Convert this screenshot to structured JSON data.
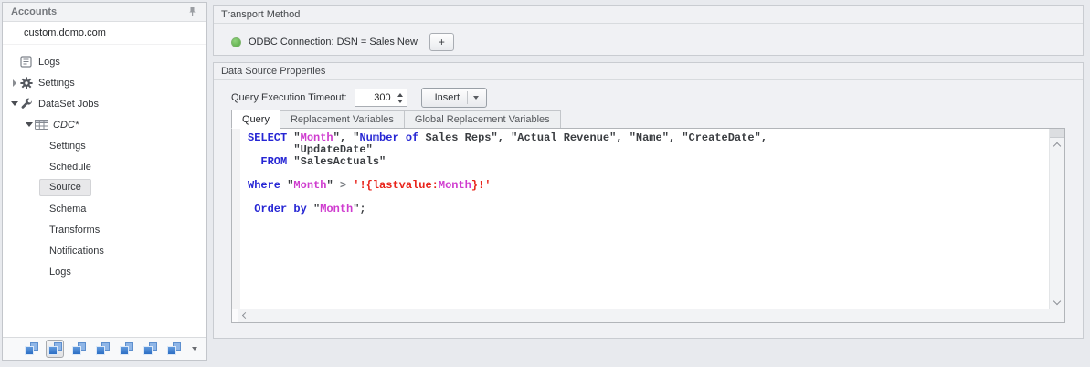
{
  "sidebar": {
    "title": "Accounts",
    "account": "custom.domo.com",
    "tree": [
      {
        "label": "Logs"
      },
      {
        "label": "Settings"
      },
      {
        "label": "DataSet Jobs"
      },
      {
        "label": "CDC*"
      },
      {
        "label": "Settings"
      },
      {
        "label": "Schedule"
      },
      {
        "label": "Source",
        "selected": true
      },
      {
        "label": "Schema"
      },
      {
        "label": "Transforms"
      },
      {
        "label": "Notifications"
      },
      {
        "label": "Logs"
      }
    ]
  },
  "transport": {
    "title": "Transport Method",
    "connection_label": "ODBC Connection: DSN = Sales New",
    "add_button_label": "+",
    "status_color": "#54a842"
  },
  "properties": {
    "title": "Data Source Properties",
    "timeout_label": "Query Execution Timeout:",
    "timeout_value": "300",
    "insert_button_label": "Insert",
    "tabs": [
      {
        "label": "Query",
        "active": true
      },
      {
        "label": "Replacement Variables",
        "active": false
      },
      {
        "label": "Global Replacement Variables",
        "active": false
      }
    ]
  },
  "editor": {
    "language": "sql",
    "token_colors": {
      "k": "#2626d4",
      "m": "#cf3ccf",
      "s": "#e8231a",
      "p": "#3a3d41",
      "o": "#7a7e83"
    },
    "lines": [
      [
        {
          "t": "SELECT",
          "c": "k"
        },
        {
          "t": " \"",
          "c": "p"
        },
        {
          "t": "Month",
          "c": "m"
        },
        {
          "t": "\", \"",
          "c": "p"
        },
        {
          "t": "Number of",
          "c": "k"
        },
        {
          "t": " Sales Reps\", \"Actual Revenue\", \"Name\", \"CreateDate\",",
          "c": "p"
        }
      ],
      [
        {
          "t": "       \"UpdateDate\"",
          "c": "p"
        }
      ],
      [
        {
          "t": "  ",
          "c": "p"
        },
        {
          "t": "FROM",
          "c": "k"
        },
        {
          "t": " \"SalesActuals\"",
          "c": "p"
        }
      ],
      [],
      [
        {
          "t": "Where",
          "c": "k"
        },
        {
          "t": " \"",
          "c": "p"
        },
        {
          "t": "Month",
          "c": "m"
        },
        {
          "t": "\" ",
          "c": "p"
        },
        {
          "t": ">",
          "c": "o"
        },
        {
          "t": " ",
          "c": "p"
        },
        {
          "t": "'!{lastvalue:",
          "c": "s"
        },
        {
          "t": "Month",
          "c": "m"
        },
        {
          "t": "}!'",
          "c": "s"
        }
      ],
      [],
      [
        {
          "t": " ",
          "c": "p"
        },
        {
          "t": "Order by",
          "c": "k"
        },
        {
          "t": " \"",
          "c": "p"
        },
        {
          "t": "Month",
          "c": "m"
        },
        {
          "t": "\";",
          "c": "p"
        }
      ]
    ]
  }
}
